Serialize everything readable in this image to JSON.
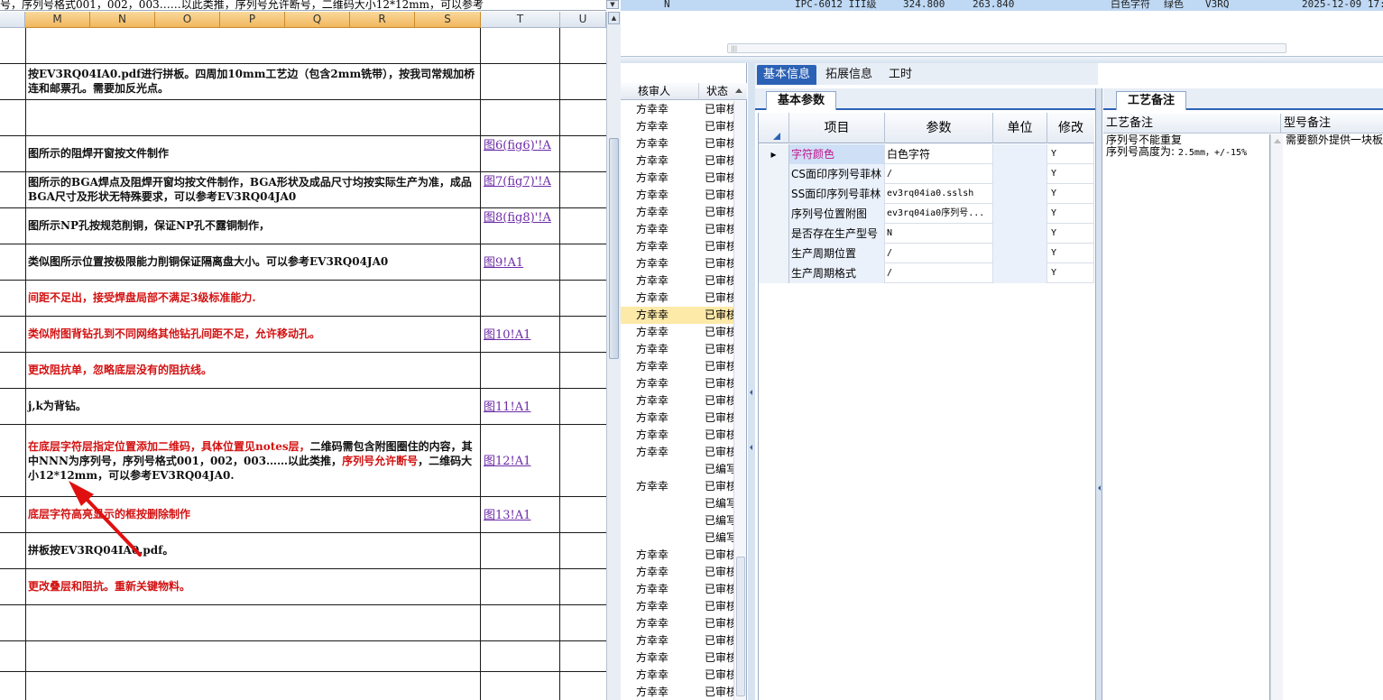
{
  "excel": {
    "formula_text": "号，序列号格式001，002，003……以此类推，序列号允许断号，二维码大小12*12mm，可以参考",
    "columns": [
      "M",
      "N",
      "O",
      "P",
      "Q",
      "R",
      "S",
      "T",
      "U"
    ],
    "rows": [
      {
        "text": ""
      },
      {
        "text": "按EV3RQ04IA0.pdf进行拼板。四周加10mm工艺边（包含2mm铣带），按我司常规加桥连和邮票孔。需要加反光点。",
        "link": ""
      },
      {
        "text": ""
      },
      {
        "text": "图所示的阻焊开窗按文件制作",
        "link": "图6(fig6)'!A"
      },
      {
        "text": "图所示的BGA焊点及阻焊开窗均按文件制作，BGA形状及成品尺寸均按实际生产为准，成品BGA尺寸及形状无特殊要求，可以参考EV3RQ04JA0",
        "link": "图7(fig7)'!A"
      },
      {
        "text": "图所示NP孔按规范削铜，保证NP孔不露铜制作，",
        "link": "图8(fig8)'!A"
      },
      {
        "text": "类似图所示位置按极限能力削铜保证隔离盘大小。可以参考EV3RQ04JA0",
        "link": "图9!A1"
      },
      {
        "text": "间距不足出，接受焊盘局部不满足3级标准能力.",
        "link": ""
      },
      {
        "text": "类似附图背钻孔到不同网络其他钻孔间距不足，允许移动孔。",
        "link": "图10!A1"
      },
      {
        "text": "更改阻抗单，忽略底层没有的阻抗线。",
        "link": ""
      },
      {
        "text": "j,k为背钻。",
        "link": "图11!A1"
      },
      {
        "text_red1": "在底层字符层指定位置添加二维码，具体位置见notes层，",
        "text_black": "二维码需包含附图圈住的内容，其中NNN为序列号，序列号格式001，002，003……以此类推，",
        "text_red2": "序列号允许断号",
        "text_black2": "，二维码大小12*12mm，可以参考EV3RQ04JA0.",
        "link": "图12!A1"
      },
      {
        "text": "底层字符高亮显示的框按删除制作",
        "link": "图13!A1"
      },
      {
        "text": "拼板按EV3RQ04IA0.pdf。",
        "link": ""
      },
      {
        "text": "更改叠层和阻抗。重新关键物料。",
        "link": ""
      }
    ]
  },
  "app": {
    "top_row": {
      "c1": "N",
      "c2": "IPC-6012 III级",
      "c3": "324.800",
      "c4": "263.840",
      "c5": "白色字符",
      "c6": "绿色",
      "c7": "V3RQ",
      "c8": "2025-12-09 17:3"
    },
    "list": {
      "headers": [
        "核审人",
        "状态"
      ],
      "rows": [
        {
          "a": "方幸幸",
          "b": "已审核"
        },
        {
          "a": "方幸幸",
          "b": "已审核"
        },
        {
          "a": "方幸幸",
          "b": "已审核"
        },
        {
          "a": "方幸幸",
          "b": "已审核"
        },
        {
          "a": "方幸幸",
          "b": "已审核"
        },
        {
          "a": "方幸幸",
          "b": "已审核"
        },
        {
          "a": "方幸幸",
          "b": "已审核"
        },
        {
          "a": "方幸幸",
          "b": "已审核"
        },
        {
          "a": "方幸幸",
          "b": "已审核"
        },
        {
          "a": "方幸幸",
          "b": "已审核"
        },
        {
          "a": "方幸幸",
          "b": "已审核"
        },
        {
          "a": "方幸幸",
          "b": "已审核"
        },
        {
          "a": "方幸幸",
          "b": "已审核"
        },
        {
          "a": "方幸幸",
          "b": "已审核"
        },
        {
          "a": "方幸幸",
          "b": "已审核"
        },
        {
          "a": "方幸幸",
          "b": "已审核"
        },
        {
          "a": "方幸幸",
          "b": "已审核"
        },
        {
          "a": "方幸幸",
          "b": "已审核"
        },
        {
          "a": "方幸幸",
          "b": "已审核"
        },
        {
          "a": "方幸幸",
          "b": "已审核"
        },
        {
          "a": "方幸幸",
          "b": "已审核"
        },
        {
          "a": "",
          "b": "已编写"
        },
        {
          "a": "方幸幸",
          "b": "已审核"
        },
        {
          "a": "",
          "b": "已编写"
        },
        {
          "a": "",
          "b": "已编写"
        },
        {
          "a": "",
          "b": "已编写"
        },
        {
          "a": "方幸幸",
          "b": "已审核"
        },
        {
          "a": "方幸幸",
          "b": "已审核"
        },
        {
          "a": "方幸幸",
          "b": "已审核"
        },
        {
          "a": "方幸幸",
          "b": "已审核"
        },
        {
          "a": "方幸幸",
          "b": "已审核"
        },
        {
          "a": "方幸幸",
          "b": "已审核"
        },
        {
          "a": "方幸幸",
          "b": "已审核"
        },
        {
          "a": "方幸幸",
          "b": "已审核"
        },
        {
          "a": "方幸幸",
          "b": "已审核"
        }
      ]
    },
    "tabs": [
      "基本信息",
      "拓展信息",
      "工时"
    ],
    "basic_params": {
      "tab_label": "基本参数",
      "headers": [
        "项目",
        "参数",
        "单位",
        "修改"
      ],
      "rows": [
        {
          "item": "字符颜色",
          "value": "白色字符",
          "unit": "",
          "mod": "Y"
        },
        {
          "item": "CS面印序列号菲林",
          "value": "/",
          "unit": "",
          "mod": "Y"
        },
        {
          "item": "SS面印序列号菲林",
          "value": "ev3rq04ia0.sslsh",
          "unit": "",
          "mod": "Y"
        },
        {
          "item": "序列号位置附图",
          "value": "ev3rq04ia0序列号...",
          "unit": "",
          "mod": "Y"
        },
        {
          "item": "是否存在生产型号",
          "value": "N",
          "unit": "",
          "mod": "Y"
        },
        {
          "item": "生产周期位置",
          "value": "/",
          "unit": "",
          "mod": "Y"
        },
        {
          "item": "生产周期格式",
          "value": "/",
          "unit": "",
          "mod": "Y"
        }
      ]
    },
    "process_notes": {
      "tab_label": "工艺备注",
      "col1_header": "工艺备注",
      "col2_header": "型号备注",
      "col1_line1": "序列号不能重复",
      "col1_line2_a": "序列号高度为:",
      "col1_line2_b": "2.5mm，+/-15%",
      "col2_line1": "需要额外提供一块板子"
    }
  }
}
